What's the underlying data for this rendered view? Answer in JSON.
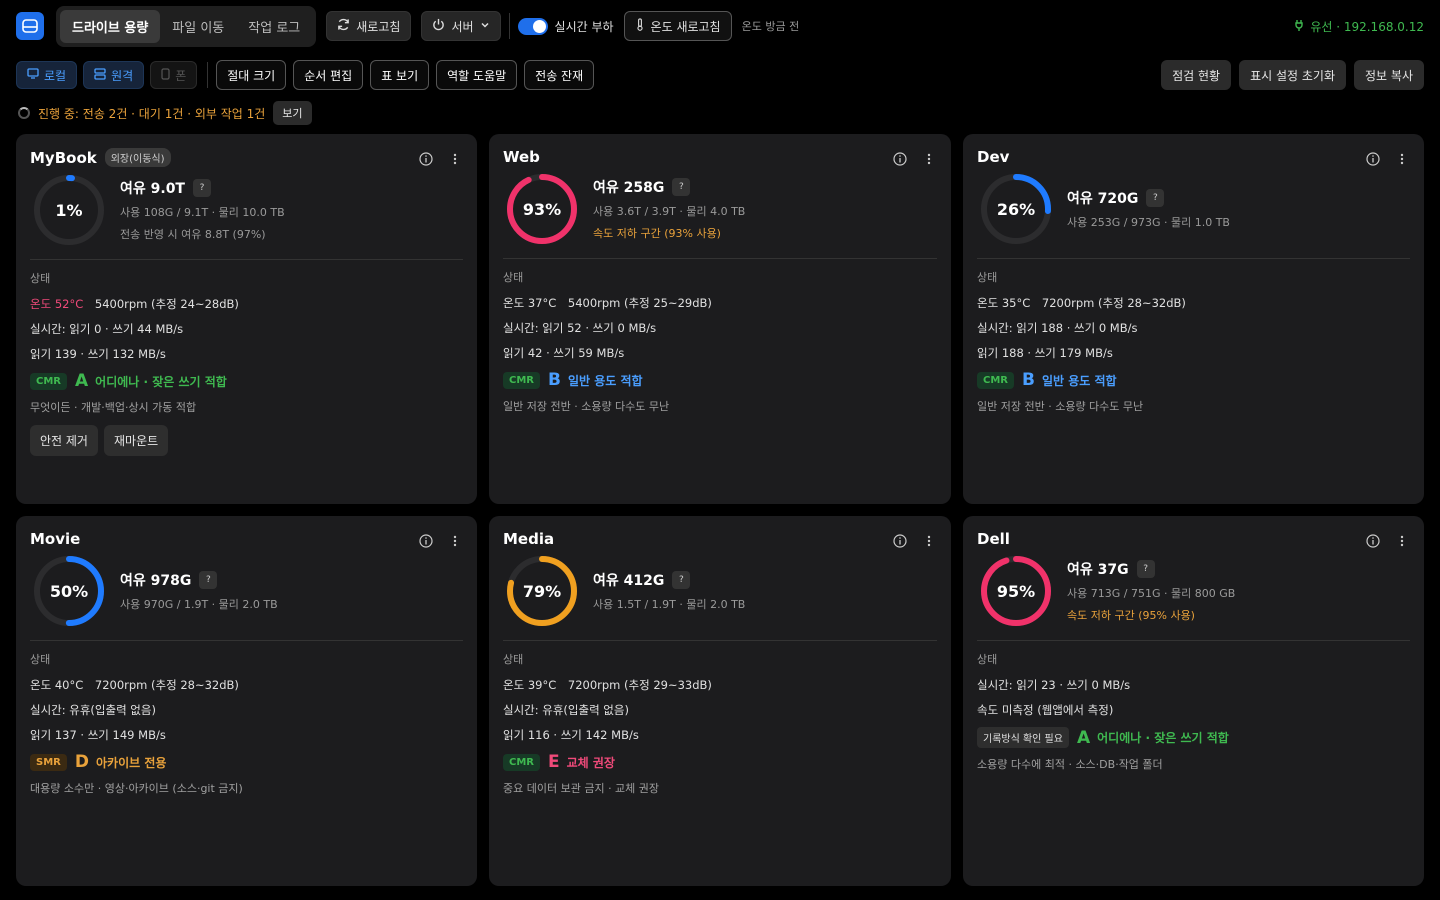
{
  "topbar": {
    "tabs": [
      "드라이브 용량",
      "파일 이동",
      "작업 로그"
    ],
    "refresh_label": "새로고침",
    "server_label": "서버",
    "realtime_label": "실시간 부하",
    "temp_refresh_label": "온도 새로고침",
    "temp_status": "온도 방금 전",
    "network": "유선 · 192.168.0.12"
  },
  "bar2": {
    "local": "로컬",
    "remote": "원격",
    "none": "폰",
    "buttons": [
      "절대 크기",
      "순서 편집",
      "표 보기",
      "역할 도움말",
      "전송 잔재"
    ],
    "right_buttons": [
      "점검 현황",
      "표시 설정 초기화",
      "정보 복사"
    ]
  },
  "progress": {
    "text": "진행 중: 전송 2건 · 대기 1건 · 외부 작업 1건",
    "view_label": "보기"
  },
  "status_label": "상태",
  "colors": {
    "accent": "#1f6feb",
    "green": "#3fb950",
    "orange": "#e9a23b",
    "pink": "#f04a7a",
    "blue": "#1f7bff"
  },
  "cards": [
    {
      "name": "MyBook",
      "badge": "외장(이동식)",
      "percent": 1,
      "percent_label": "1%",
      "gauge_color": "#1f7bff",
      "free": "여유 9.0T",
      "usage": "사용 108G / 9.1T · 물리 10.0 TB",
      "extra": "전송 반영 시 여유 8.8T (97%)",
      "extra_warn": false,
      "temp": "온도 52°C",
      "temp_hot": true,
      "rpm": "5400rpm (추정 24~28dB)",
      "realtime": "실시간: 읽기 0 · 쓰기 44 MB/s",
      "rw": "읽기 139 · 쓰기 132 MB/s",
      "tag": "CMR",
      "tag_type": "cmr",
      "grade": "A",
      "grade_desc": "어디에나 · 잦은 쓰기 적합",
      "note": "무엇이든 · 개발·백업·상시 가동 적합",
      "buttons": [
        "안전 제거",
        "재마운트"
      ]
    },
    {
      "name": "Web",
      "badge": "",
      "percent": 93,
      "percent_label": "93%",
      "gauge_color": "#f0326a",
      "free": "여유 258G",
      "usage": "사용 3.6T / 3.9T · 물리 4.0 TB",
      "extra": "속도 저하 구간 (93% 사용)",
      "extra_warn": true,
      "temp": "온도 37°C",
      "temp_hot": false,
      "rpm": "5400rpm (추정 25~29dB)",
      "realtime": "실시간: 읽기 52 · 쓰기 0 MB/s",
      "rw": "읽기 42 · 쓰기 59 MB/s",
      "tag": "CMR",
      "tag_type": "cmr",
      "grade": "B",
      "grade_desc": "일반 용도 적합",
      "note": "일반 저장 전반 · 소용량 다수도 무난"
    },
    {
      "name": "Dev",
      "badge": "",
      "percent": 26,
      "percent_label": "26%",
      "gauge_color": "#1f7bff",
      "free": "여유 720G",
      "usage": "사용 253G / 973G · 물리 1.0 TB",
      "extra": "",
      "extra_warn": false,
      "temp": "온도 35°C",
      "temp_hot": false,
      "rpm": "7200rpm (추정 28~32dB)",
      "realtime": "실시간: 읽기 188 · 쓰기 0 MB/s",
      "rw": "읽기 188 · 쓰기 179 MB/s",
      "tag": "CMR",
      "tag_type": "cmr",
      "grade": "B",
      "grade_desc": "일반 용도 적합",
      "note": "일반 저장 전반 · 소용량 다수도 무난"
    },
    {
      "name": "Movie",
      "badge": "",
      "percent": 50,
      "percent_label": "50%",
      "gauge_color": "#1f7bff",
      "free": "여유 978G",
      "usage": "사용 970G / 1.9T · 물리 2.0 TB",
      "extra": "",
      "extra_warn": false,
      "temp": "온도 40°C",
      "temp_hot": false,
      "rpm": "7200rpm (추정 28~32dB)",
      "realtime": "실시간: 유휴(입출력 없음)",
      "rw": "읽기 137 · 쓰기 149 MB/s",
      "tag": "SMR",
      "tag_type": "smr",
      "grade": "D",
      "grade_desc": "아카이브 전용",
      "note": "대용량 소수만 · 영상·아카이브 (소스·git 금지)"
    },
    {
      "name": "Media",
      "badge": "",
      "percent": 79,
      "percent_label": "79%",
      "gauge_color": "#f0a020",
      "free": "여유 412G",
      "usage": "사용 1.5T / 1.9T · 물리 2.0 TB",
      "extra": "",
      "extra_warn": false,
      "temp": "온도 39°C",
      "temp_hot": false,
      "rpm": "7200rpm (추정 29~33dB)",
      "realtime": "실시간: 유휴(입출력 없음)",
      "rw": "읽기 116 · 쓰기 142 MB/s",
      "tag": "CMR",
      "tag_type": "cmr",
      "grade": "E",
      "grade_desc": "교체 권장",
      "note": "중요 데이터 보관 금지 · 교체 권장"
    },
    {
      "name": "Dell",
      "badge": "",
      "percent": 95,
      "percent_label": "95%",
      "gauge_color": "#f0326a",
      "free": "여유 37G",
      "usage": "사용 713G / 751G · 물리 800 GB",
      "extra": "속도 저하 구간 (95% 사용)",
      "extra_warn": true,
      "temp": "",
      "temp_hot": false,
      "rpm": "",
      "realtime": "실시간: 읽기 23 · 쓰기 0 MB/s",
      "rw": "속도 미측정 (웹앱에서 측정)",
      "tag": "기록방식 확인 필요",
      "tag_type": "chk",
      "grade": "A",
      "grade_desc": "어디에나 · 잦은 쓰기 적합",
      "note": "소용량 다수에 최적 · 소스·DB·작업 폴더"
    }
  ]
}
